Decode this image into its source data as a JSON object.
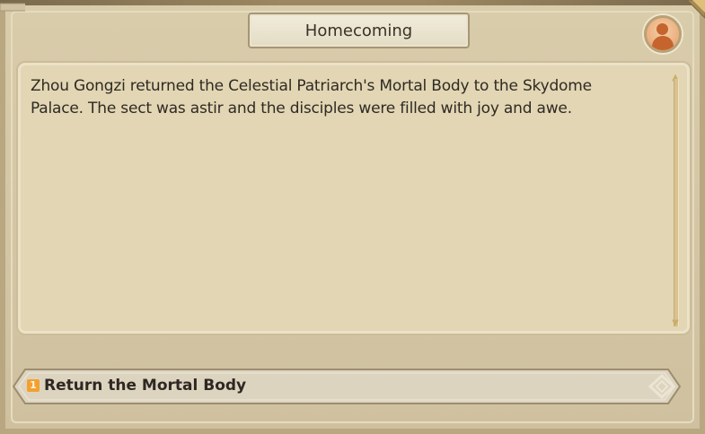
{
  "dialog": {
    "title": "Homecoming",
    "text": "Zhou Gongzi returned the Celestial Patriarch's Mortal Body to the Skydome Palace. The sect was astir and the disciples were filled with joy and awe."
  },
  "choices": [
    {
      "number": "1",
      "label": "Return the Mortal Body"
    }
  ],
  "icons": {
    "avatar": "character-avatar-icon",
    "scroll_up": "scroll-up-arrow-icon",
    "scroll_down": "scroll-down-arrow-icon",
    "choice_arrow": "diamond-arrow-icon"
  },
  "colors": {
    "frame": "#b9a781",
    "panel": "#e2d6b4",
    "accent": "#f3a030",
    "avatar": "#e89c6a"
  }
}
